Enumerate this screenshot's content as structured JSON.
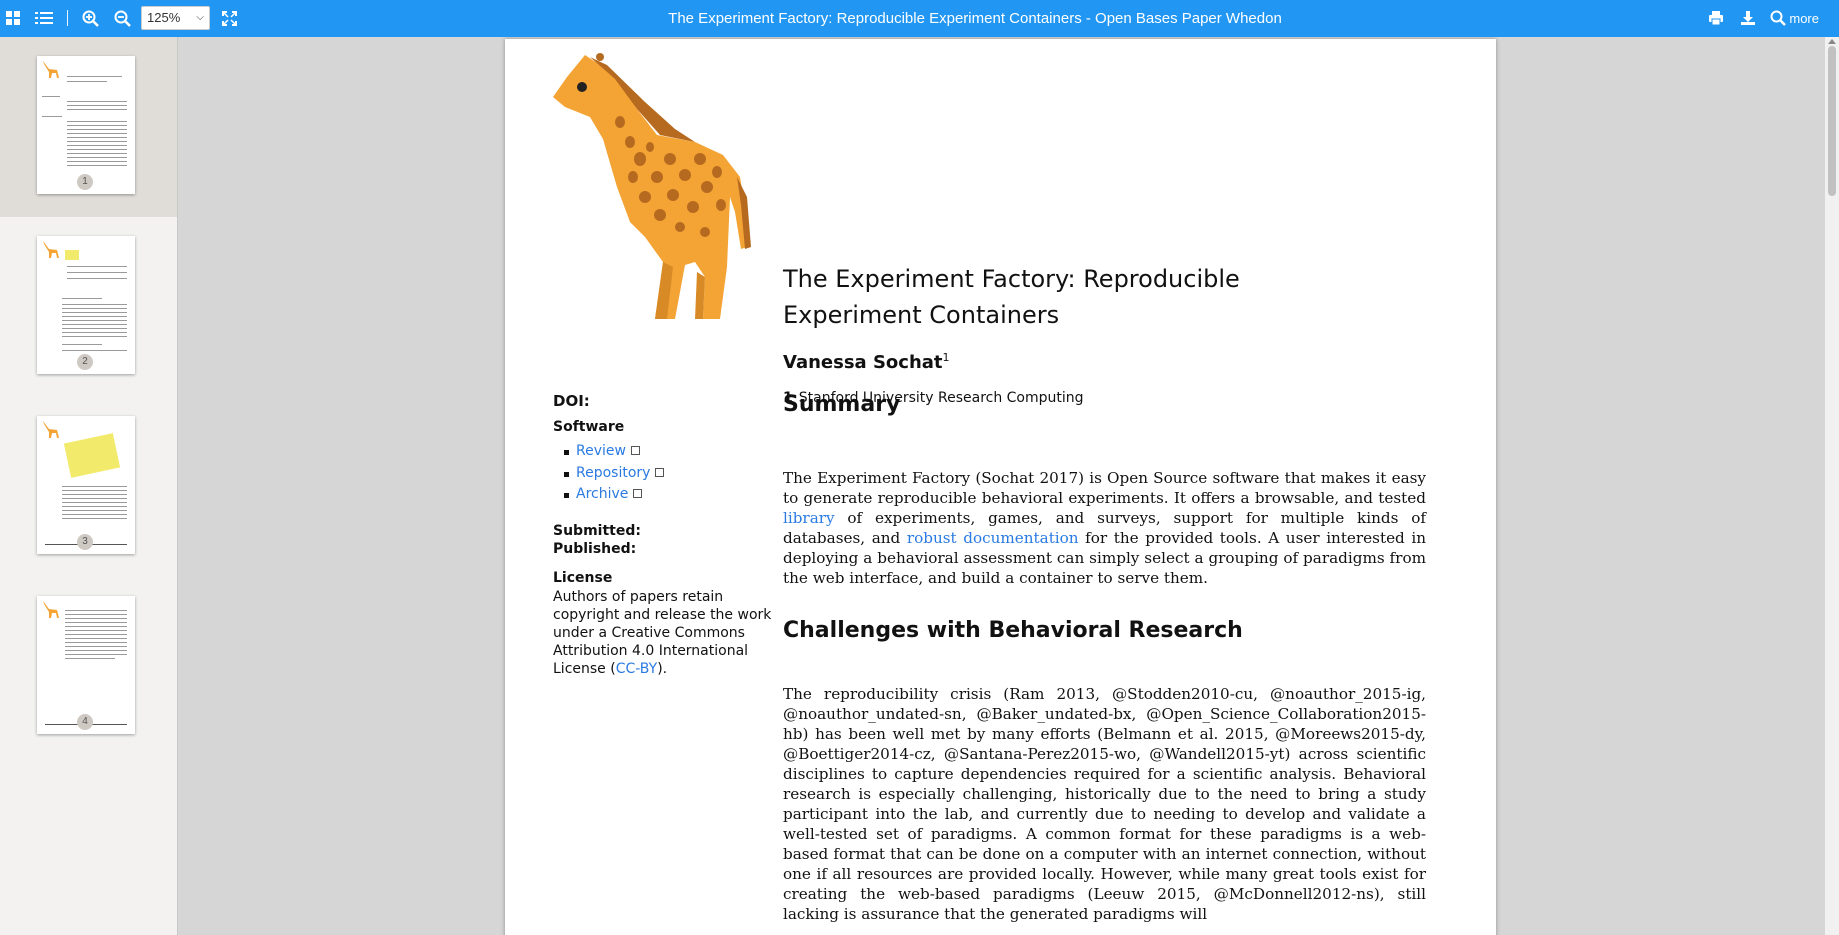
{
  "toolbar": {
    "title": "The Experiment Factory: Reproducible Experiment Containers - Open Bases Paper Whedon",
    "zoom": "125%",
    "more_label": "more",
    "accent": "#2196f3"
  },
  "sidebar": {
    "thumbnails": [
      {
        "page": "1"
      },
      {
        "page": "2"
      },
      {
        "page": "3"
      },
      {
        "page": "4"
      }
    ]
  },
  "paper": {
    "title": "The Experiment Factory: Reproducible Experiment Containers",
    "author": "Vanessa Sochat",
    "author_sup": "1",
    "affil_num": "1",
    "affil_text": "Stanford University Research Computing",
    "doi_label": "DOI:",
    "software_label": "Software",
    "links": [
      "Review",
      "Repository",
      "Archive"
    ],
    "submitted_label": "Submitted:",
    "published_label": "Published:",
    "license_label": "License",
    "license_text_pre": "Authors of papers retain copyright and release the work under a Creative Commons Attribution 4.0 International License (",
    "license_link": "CC-BY",
    "license_text_post": ").",
    "summary_heading": "Summary",
    "summary": {
      "p1": "The Experiment Factory (Sochat 2017) is Open Source software that makes it easy to generate reproducible behavioral experiments. It offers a browsable, and tested ",
      "link1": "library",
      "p2": " of experiments, games, and surveys, support for multiple kinds of databases, and ",
      "link2": "robust documentation",
      "p3": " for the provided tools. A user interested in deploying a behavioral assessment can simply select a grouping of paradigms from the web interface, and build a container to serve them."
    },
    "challenges_heading": "Challenges with Behavioral Research",
    "challenges_text": "The reproducibility crisis (Ram 2013, @Stodden2010-cu, @noauthor_2015-ig, @noauthor_undated-sn, @Baker_undated-bx, @Open_Science_Collaboration2015-hb) has been well met by many efforts (Belmann et al. 2015, @Moreews2015-dy, @Boettiger2014-cz, @Santana-Perez2015-wo, @Wandell2015-yt) across scientific disciplines to capture dependencies required for a scientific analysis. Behavioral research is especially challenging, historically due to the need to bring a study participant into the lab, and currently due to needing to develop and validate a well-tested set of paradigms. A common format for these paradigms is a web-based format that can be done on a computer with an internet connection, without one if all resources are provided locally. However, while many great tools exist for creating the web-based paradigms (Leeuw 2015, @McDonnell2012-ns), still lacking is assurance that the generated paradigms will"
  }
}
